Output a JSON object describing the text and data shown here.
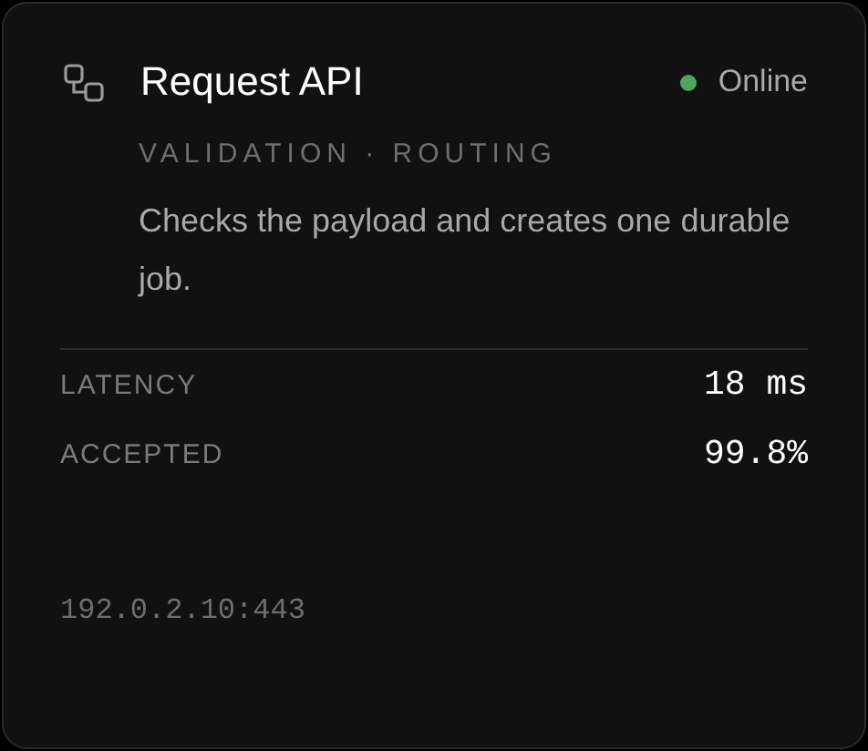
{
  "card": {
    "title": "Request API",
    "status": {
      "label": "Online",
      "color": "#4ea65e"
    },
    "tags": "VALIDATION · ROUTING",
    "description": "Checks the payload and creates one durable job.",
    "metrics": [
      {
        "label": "LATENCY",
        "value": "18 ms"
      },
      {
        "label": "ACCEPTED",
        "value": "99.8%"
      }
    ],
    "address": "192.0.2.10:443"
  }
}
